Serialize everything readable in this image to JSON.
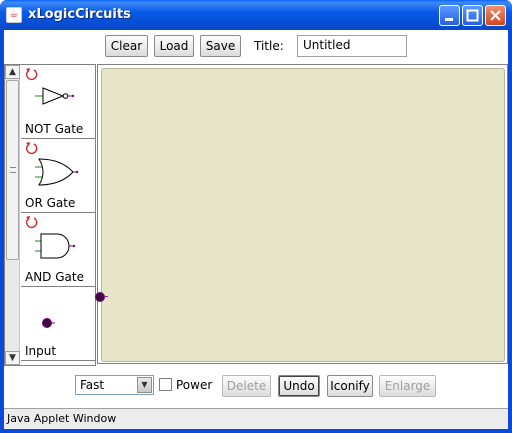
{
  "window": {
    "title": "xLogicCircuits"
  },
  "toolbar_top": {
    "clear": "Clear",
    "load": "Load",
    "save": "Save",
    "title_label": "Title:",
    "title_value": "Untitled"
  },
  "palette": {
    "items": [
      {
        "label": "NOT Gate",
        "icon": "not-gate-icon"
      },
      {
        "label": "OR Gate",
        "icon": "or-gate-icon"
      },
      {
        "label": "AND Gate",
        "icon": "and-gate-icon"
      },
      {
        "label": "Input",
        "icon": "input-pin-icon"
      }
    ]
  },
  "toolbar_bottom": {
    "speed_selected": "Fast",
    "power_label": "Power",
    "power_checked": false,
    "delete": "Delete",
    "undo": "Undo",
    "iconify": "Iconify",
    "enlarge": "Enlarge"
  },
  "status": {
    "text": "Java Applet Window"
  },
  "colors": {
    "titlebar": "#0a5ae8",
    "canvas": "#e7e5c7",
    "rotate_icon": "#cc2222",
    "pin": "#800080"
  }
}
